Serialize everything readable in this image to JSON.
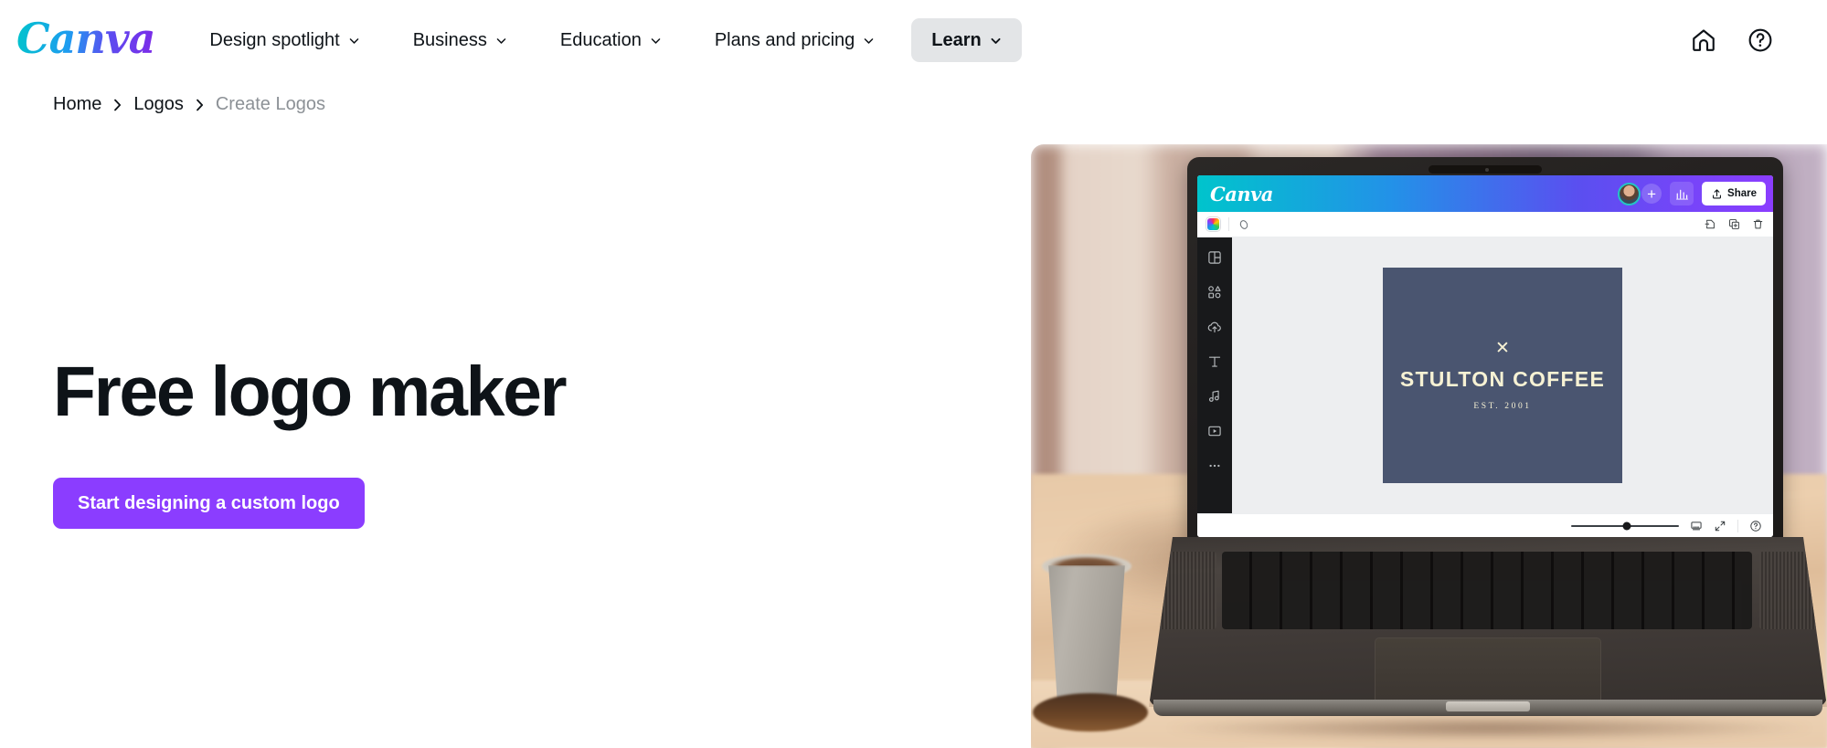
{
  "brand": {
    "logo_text": "Canva",
    "gradient_start": "#00C4CC",
    "gradient_end": "#7D2AE8"
  },
  "topnav": {
    "items": [
      {
        "label": "Design spotlight",
        "has_chevron": true,
        "active": false
      },
      {
        "label": "Business",
        "has_chevron": true,
        "active": false
      },
      {
        "label": "Education",
        "has_chevron": true,
        "active": false
      },
      {
        "label": "Plans and pricing",
        "has_chevron": true,
        "active": false
      },
      {
        "label": "Learn",
        "has_chevron": true,
        "active": true
      }
    ],
    "right_icons": [
      {
        "name": "home-icon"
      },
      {
        "name": "help-icon"
      }
    ]
  },
  "breadcrumb": {
    "items": [
      {
        "label": "Home",
        "current": false
      },
      {
        "label": "Logos",
        "current": false
      },
      {
        "label": "Create Logos",
        "current": true
      }
    ],
    "separator_icon": "chevron-right-icon"
  },
  "hero": {
    "title": "Free logo maker",
    "cta_label": "Start designing a custom logo",
    "cta_color": "#8B3DFF"
  },
  "editor_mock": {
    "logo_text": "Canva",
    "share_label": "Share",
    "topbar_icons": [
      "avatar",
      "add-collaborator-icon",
      "insights-icon",
      "share-icon"
    ],
    "toolbar_icons": [
      "color-swatch",
      "transparency-icon",
      "add-page-icon",
      "duplicate-page-icon",
      "delete-page-icon"
    ],
    "sidebar_icons": [
      "templates-icon",
      "elements-icon",
      "uploads-icon",
      "text-icon",
      "audio-icon",
      "videos-icon",
      "more-icon"
    ],
    "bottombar_icons": [
      "pages-icon",
      "fullscreen-icon",
      "help-icon"
    ],
    "design": {
      "mark": "✕",
      "name": "STULTON COFFEE",
      "established": "EST. 2001",
      "background_color": "#4A5570",
      "text_color": "#F7F2D4"
    }
  }
}
